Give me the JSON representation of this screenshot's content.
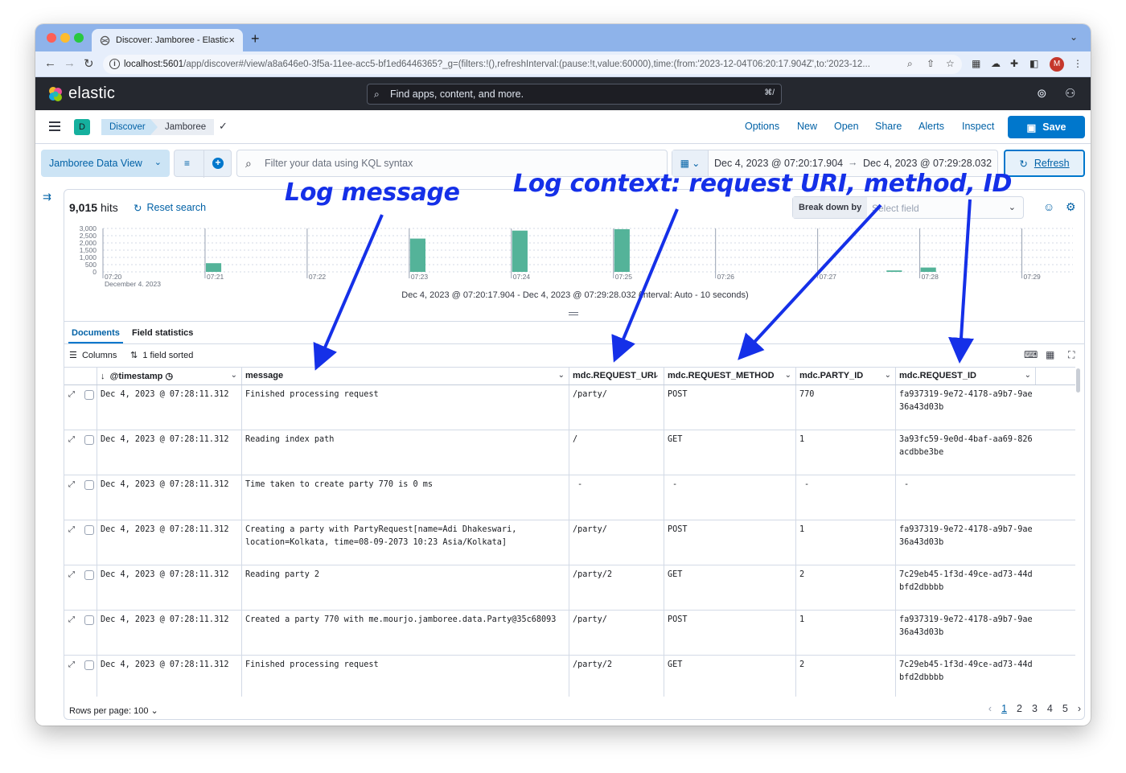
{
  "browser": {
    "tab_title": "Discover: Jamboree - Elastic",
    "tab_close": "×",
    "new_tab": "+",
    "url_host": "localhost:5601",
    "url_path": "/app/discover#/view/a8a646e0-3f5a-11ee-acc5-bf1ed6446365?_g=(filters:!(),refreshInterval:(pause:!t,value:60000),time:(from:'2023-12-04T06:20:17.904Z',to:'2023-12...",
    "profile_initial": "M",
    "colors": {
      "close": "#ff5f57",
      "minimize": "#febc2e",
      "maximize": "#28c840"
    }
  },
  "header": {
    "brand": "elastic",
    "search_placeholder": "Find apps, content, and more.",
    "search_shortcut": "⌘/"
  },
  "appbar": {
    "space_initial": "D",
    "breadcrumbs": [
      "Discover",
      "Jamboree"
    ],
    "menu": [
      "Options",
      "New",
      "Open",
      "Share",
      "Alerts",
      "Inspect"
    ],
    "save_label": "Save"
  },
  "querybar": {
    "data_view": "Jamboree Data View",
    "kql_placeholder": "Filter your data using KQL syntax",
    "time_start": "Dec 4, 2023 @ 07:20:17.904",
    "time_end": "Dec 4, 2023 @ 07:29:28.032",
    "refresh_label": "Refresh"
  },
  "summary": {
    "hits_count": "9,015",
    "hits_label": "hits",
    "reset_label": "Reset search",
    "breakdown_label": "Break down by",
    "breakdown_placeholder": "Select field"
  },
  "chart_data": {
    "type": "bar",
    "x": [
      "07:20",
      "07:20:10",
      "07:20:20",
      "07:20:30",
      "07:20:40",
      "07:20:50",
      "07:21",
      "07:21:10",
      "07:21:20",
      "07:21:30",
      "07:21:40",
      "07:21:50",
      "07:22",
      "07:22:10",
      "07:22:20",
      "07:22:30",
      "07:22:40",
      "07:22:50",
      "07:23",
      "07:23:10",
      "07:23:20",
      "07:23:30",
      "07:23:40",
      "07:23:50",
      "07:24",
      "07:24:10",
      "07:24:20",
      "07:24:30",
      "07:24:40",
      "07:24:50",
      "07:25",
      "07:25:10",
      "07:25:20",
      "07:25:30",
      "07:25:40",
      "07:25:50",
      "07:26",
      "07:26:10",
      "07:26:20",
      "07:26:30",
      "07:26:40",
      "07:26:50",
      "07:27",
      "07:27:10",
      "07:27:20",
      "07:27:30",
      "07:27:40",
      "07:27:50",
      "07:28",
      "07:28:10",
      "07:28:20",
      "07:28:30",
      "07:28:40",
      "07:28:50",
      "07:29",
      "07:29:10",
      "07:29:20"
    ],
    "values": [
      0,
      0,
      0,
      0,
      0,
      0,
      600,
      0,
      0,
      0,
      0,
      0,
      0,
      0,
      0,
      0,
      0,
      0,
      2300,
      0,
      0,
      0,
      0,
      0,
      2850,
      0,
      0,
      0,
      0,
      0,
      2950,
      0,
      0,
      0,
      0,
      0,
      0,
      0,
      0,
      0,
      0,
      0,
      0,
      0,
      0,
      0,
      100,
      0,
      300,
      0,
      0,
      0,
      0,
      0,
      0,
      0,
      0
    ],
    "ylim": [
      0,
      3000
    ],
    "yticks": [
      "3,000",
      "2,500",
      "2,000",
      "1,500",
      "1,000",
      "500",
      "0"
    ],
    "xticks": [
      "07:20",
      "07:21",
      "07:22",
      "07:23",
      "07:24",
      "07:25",
      "07:26",
      "07:27",
      "07:28",
      "07:29"
    ],
    "xsub": "December 4, 2023",
    "grid": true,
    "bar_color": "#54b399",
    "caption": "Dec 4, 2023 @ 07:20:17.904 - Dec 4, 2023 @ 07:29:28.032 (interval: Auto - 10 seconds)"
  },
  "tabs": [
    "Documents",
    "Field statistics"
  ],
  "toolbar": {
    "columns_label": "Columns",
    "sort_label": "1 field sorted"
  },
  "grid": {
    "columns": [
      "@timestamp",
      "message",
      "mdc.REQUEST_URI",
      "mdc.REQUEST_METHOD",
      "mdc.PARTY_ID",
      "mdc.REQUEST_ID"
    ],
    "rows": [
      [
        "Dec 4, 2023 @ 07:28:11.312",
        "Finished processing request",
        "/party/",
        "POST",
        "770",
        "fa937319-9e72-4178-a9b7-9ae36a43d03b"
      ],
      [
        "Dec 4, 2023 @ 07:28:11.312",
        "Reading index path",
        "/",
        "GET",
        "1",
        "3a93fc59-9e0d-4baf-aa69-826acdbbe3be"
      ],
      [
        "Dec 4, 2023 @ 07:28:11.312",
        "Time taken to create party 770 is 0 ms",
        "-",
        "-",
        "-",
        "-"
      ],
      [
        "Dec 4, 2023 @ 07:28:11.312",
        "Creating a party with PartyRequest[name=Adi Dhakeswari, location=Kolkata, time=08-09-2073 10:23 Asia/Kolkata]",
        "/party/",
        "POST",
        "1",
        "fa937319-9e72-4178-a9b7-9ae36a43d03b"
      ],
      [
        "Dec 4, 2023 @ 07:28:11.312",
        "Reading party 2",
        "/party/2",
        "GET",
        "2",
        "7c29eb45-1f3d-49ce-ad73-44dbfd2dbbbb"
      ],
      [
        "Dec 4, 2023 @ 07:28:11.312",
        "Created a party 770 with me.mourjo.jamboree.data.Party@35c68093",
        "/party/",
        "POST",
        "1",
        "fa937319-9e72-4178-a9b7-9ae36a43d03b"
      ],
      [
        "Dec 4, 2023 @ 07:28:11.312",
        "Finished processing request",
        "/party/2",
        "GET",
        "2",
        "7c29eb45-1f3d-49ce-ad73-44dbfd2dbbbb"
      ]
    ]
  },
  "footer": {
    "rows_per_page": "Rows per page: 100",
    "pages": [
      "1",
      "2",
      "3",
      "4",
      "5"
    ],
    "current_page": "1"
  },
  "annotations": {
    "log_message": "Log message",
    "log_context": "Log context: request URI, method, ID",
    "color": "#1530e8"
  }
}
